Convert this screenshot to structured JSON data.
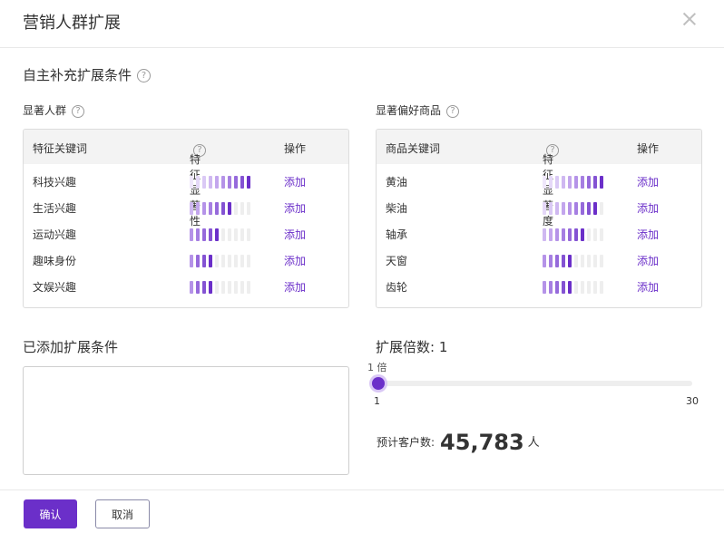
{
  "dialog": {
    "title": "营销人群扩展"
  },
  "section": {
    "title": "自主补充扩展条件",
    "help_icon": "question-circle-icon"
  },
  "people": {
    "label": "显著人群",
    "columns": {
      "keyword": "特征关键词",
      "significance": "特征显著性",
      "action": "操作"
    },
    "rows": [
      {
        "keyword": "科技兴趣",
        "level": 10,
        "action": "添加"
      },
      {
        "keyword": "生活兴趣",
        "level": 7,
        "action": "添加"
      },
      {
        "keyword": "运动兴趣",
        "level": 5,
        "action": "添加"
      },
      {
        "keyword": "趣味身份",
        "level": 4,
        "action": "添加"
      },
      {
        "keyword": "文娱兴趣",
        "level": 4,
        "action": "添加"
      }
    ]
  },
  "products": {
    "label": "显著偏好商品",
    "columns": {
      "keyword": "商品关键词",
      "significance": "特征显著度",
      "action": "操作"
    },
    "rows": [
      {
        "keyword": "黄油",
        "level": 10,
        "action": "添加"
      },
      {
        "keyword": "柴油",
        "level": 9,
        "action": "添加"
      },
      {
        "keyword": "轴承",
        "level": 7,
        "action": "添加"
      },
      {
        "keyword": "天窗",
        "level": 5,
        "action": "添加"
      },
      {
        "keyword": "齿轮",
        "level": 5,
        "action": "添加"
      }
    ]
  },
  "bars_total": 10,
  "colors": {
    "accent": "#6b2fc9",
    "bar_empty": "#eeeeee",
    "bar_shades": [
      "#efe7fb",
      "#e5d8f8",
      "#dac9f5",
      "#cfb8f1",
      "#c3a6ed",
      "#b593e8",
      "#a67fe2",
      "#966adb",
      "#8453d3",
      "#6b2fc9"
    ]
  },
  "added": {
    "title": "已添加扩展条件"
  },
  "multiplier": {
    "title": "扩展倍数: 1",
    "tip": "1 倍",
    "value": 1,
    "min": "1",
    "max": "30"
  },
  "estimate": {
    "label": "预计客户数:",
    "value": "45,783",
    "unit": "人"
  },
  "footer": {
    "ok": "确认",
    "cancel": "取消"
  }
}
